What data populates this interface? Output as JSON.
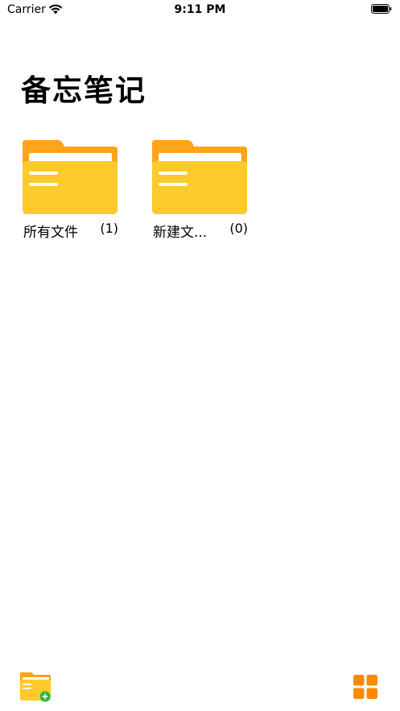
{
  "status_bar": {
    "carrier": "Carrier",
    "time": "9:11 PM",
    "icons": [
      "wifi-icon",
      "battery-icon"
    ]
  },
  "header": {
    "title": "备忘笔记"
  },
  "folders": [
    {
      "name": "所有文件",
      "count": "(1)",
      "icon": "folder-icon"
    },
    {
      "name": "新建文...",
      "count": "(0)",
      "icon": "folder-icon"
    }
  ],
  "toolbar": {
    "left_icon": "new-folder-icon",
    "right_icon": "grid-view-icon"
  },
  "colors": {
    "folder_back": "#FFA41B",
    "folder_front": "#FFCA2C",
    "folder_lines": "#FFFFFF",
    "add_badge": "#2DB83D",
    "grid_icon": "#FF8A00"
  }
}
